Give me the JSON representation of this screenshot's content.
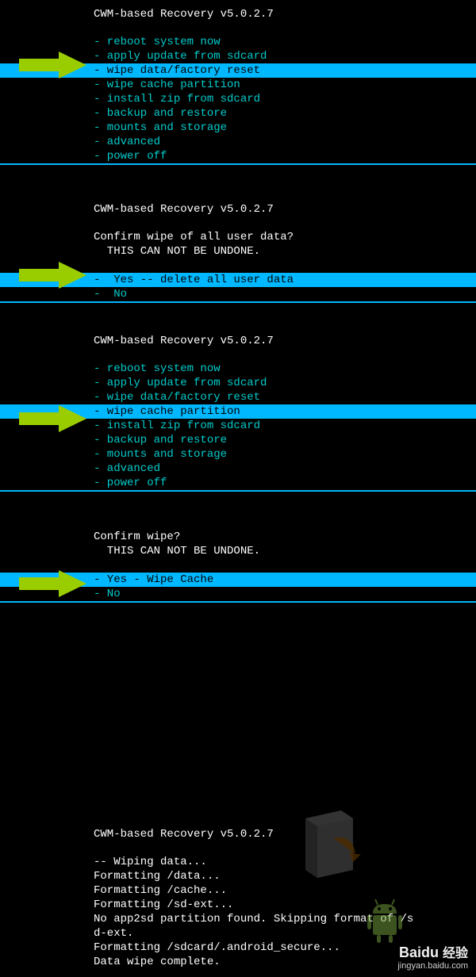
{
  "recovery_title": "CWM-based Recovery v5.0.2.7",
  "menu1": {
    "items": [
      "- reboot system now",
      "- apply update from sdcard",
      "- wipe data/factory reset",
      "- wipe cache partition",
      "- install zip from sdcard",
      "- backup and restore",
      "- mounts and storage",
      "- advanced",
      "- power off"
    ],
    "selected_index": 2
  },
  "confirm1": {
    "question": "Confirm wipe of all user data?",
    "warning": "  THIS CAN NOT BE UNDONE.",
    "options": [
      "-  Yes -- delete all user data",
      "-  No"
    ],
    "selected_index": 0
  },
  "menu2": {
    "items": [
      "- reboot system now",
      "- apply update from sdcard",
      "- wipe data/factory reset",
      "- wipe cache partition",
      "- install zip from sdcard",
      "- backup and restore",
      "- mounts and storage",
      "- advanced",
      "- power off"
    ],
    "selected_index": 3
  },
  "confirm2": {
    "question": "Confirm wipe?",
    "warning": "  THIS CAN NOT BE UNDONE.",
    "options": [
      "- Yes - Wipe Cache",
      "- No"
    ],
    "selected_index": 0
  },
  "log": {
    "lines": [
      "-- Wiping data...",
      "Formatting /data...",
      "Formatting /cache...",
      "Formatting /sd-ext...",
      "No app2sd partition found. Skipping format of /s",
      "d-ext.",
      "Formatting /sdcard/.android_secure...",
      "Data wipe complete."
    ]
  },
  "watermark": {
    "brand": "Baidu 经验",
    "sub": "jingyan.baidu.com"
  },
  "colors": {
    "highlight": "#00b8ff",
    "text_cyan": "#00cccc",
    "arrow": "#9acd00"
  }
}
